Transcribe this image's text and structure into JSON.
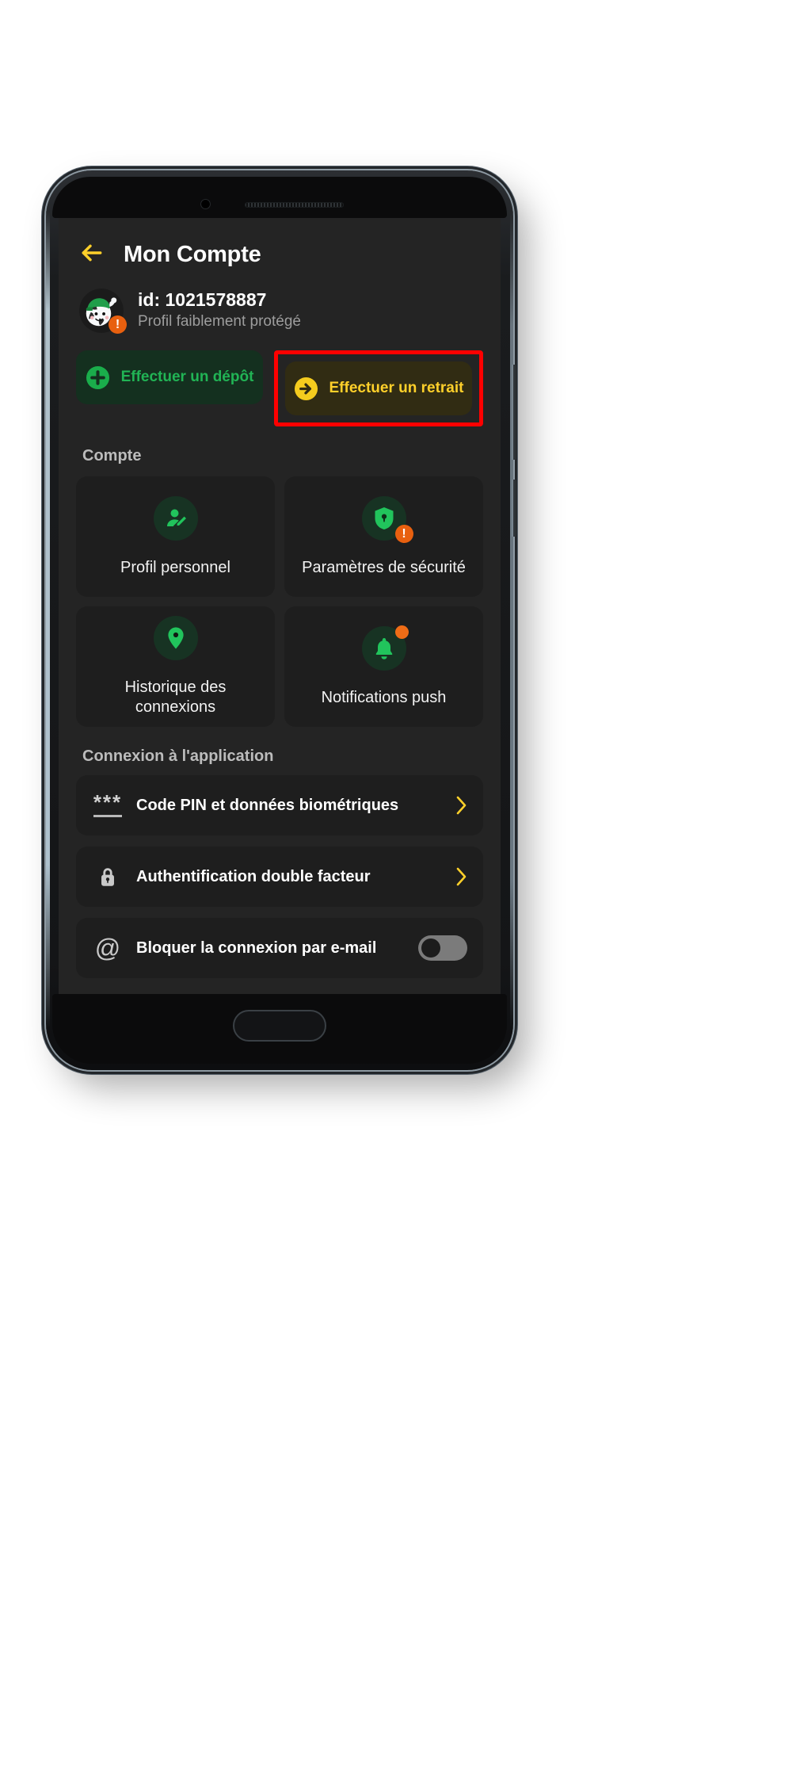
{
  "colors": {
    "screen_bg": "#242424",
    "card_bg": "#1e1e1e",
    "accent_green": "#21b455",
    "accent_yellow": "#ffd02a",
    "deposit_bg": "#14301f",
    "withdraw_bg": "#312c13",
    "highlight_red": "#ff0000",
    "warning_orange": "#e8600f",
    "muted_text": "#9d9d9d",
    "section_heading": "#bcbcbc"
  },
  "header": {
    "back_icon": "back-arrow-icon",
    "title": "Mon Compte"
  },
  "profile": {
    "avatar_icon": "football-mascot-avatar",
    "warning_badge": "!",
    "id": "id: 1021578887",
    "status": "Profil faiblement protégé"
  },
  "actions": {
    "deposit": {
      "label": "Effectuer un dépôt",
      "icon": "plus-circle-icon"
    },
    "withdraw": {
      "label": "Effectuer un retrait",
      "icon": "arrow-right-circle-icon",
      "highlighted": true
    }
  },
  "account_section": {
    "heading": "Compte",
    "cards": [
      {
        "label": "Profil personnel",
        "icon": "user-edit-icon",
        "badge": "none"
      },
      {
        "label": "Paramètres de sécurité",
        "icon": "shield-lock-icon",
        "badge": "warning"
      },
      {
        "label": "Historique des connexions",
        "icon": "location-pin-icon",
        "badge": "none"
      },
      {
        "label": "Notifications push",
        "icon": "bell-icon",
        "badge": "dot"
      }
    ]
  },
  "login_section": {
    "heading": "Connexion à l'application",
    "rows": [
      {
        "label": "Code PIN et données biométriques",
        "icon": "asterisks-icon",
        "trailing": "chevron-right-icon"
      },
      {
        "label": "Authentification double facteur",
        "icon": "lock-icon",
        "trailing": "chevron-right-icon"
      },
      {
        "label": "Bloquer la connexion par e-mail",
        "icon": "at-sign-icon",
        "trailing": "toggle-switch-off"
      }
    ]
  }
}
